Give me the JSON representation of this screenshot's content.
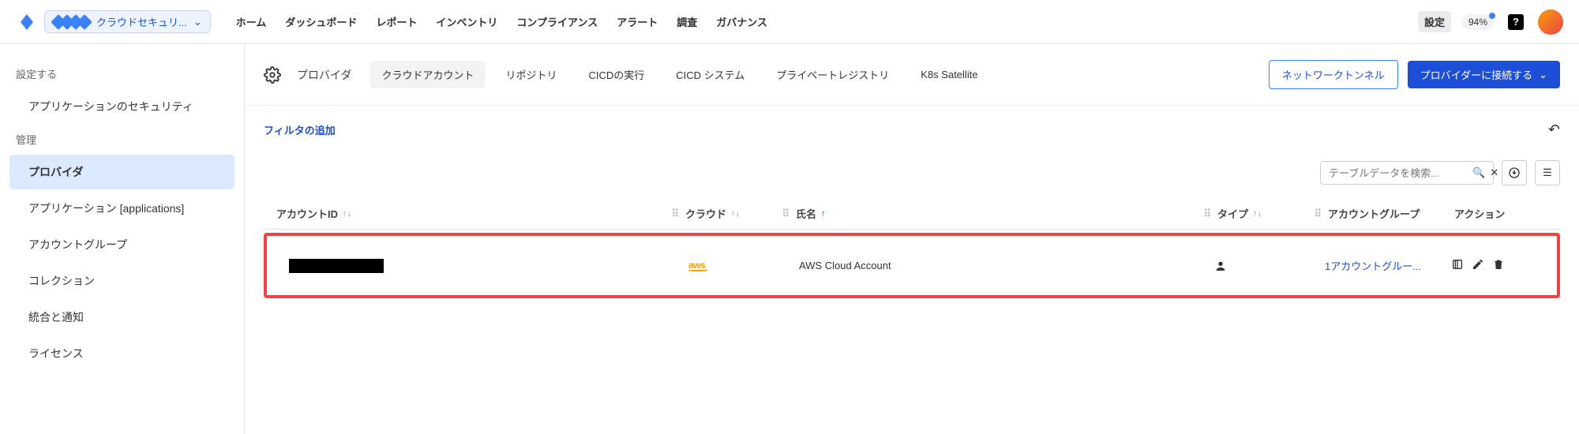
{
  "topbar": {
    "product_label": "クラウドセキュリ...",
    "nav": [
      "ホーム",
      "ダッシュボード",
      "レポート",
      "インベントリ",
      "コンプライアンス",
      "アラート",
      "調査",
      "ガバナンス"
    ],
    "settings_label": "設定",
    "percent": "94%"
  },
  "sidebar": {
    "header_configure": "設定する",
    "item_appsec": "アプリケーションのセキュリティ",
    "header_manage": "管理",
    "items": {
      "provider": "プロバイダ",
      "applications": "アプリケーション [applications]",
      "account_groups": "アカウントグループ",
      "collections": "コレクション",
      "integrations": "統合と通知",
      "license": "ライセンス"
    }
  },
  "subnav": {
    "title": "プロバイダ",
    "tabs": {
      "cloud_accounts": "クラウドアカウント",
      "repository": "リポジトリ",
      "cicd_runs": "CICDの実行",
      "cicd_systems": "CICD システム",
      "private_registry": "プライベートレジストリ",
      "k8s_satellite": "K8s Satellite"
    },
    "network_tunnel": "ネットワークトンネル",
    "connect_provider": "プロバイダーに接続する"
  },
  "filters": {
    "add": "フィルタの追加"
  },
  "table": {
    "search_placeholder": "テーブルデータを検索...",
    "headers": {
      "account_id": "アカウントID",
      "cloud": "クラウド",
      "name": "氏名",
      "type": "タイプ",
      "account_group": "アカウントグループ",
      "actions": "アクション"
    },
    "row": {
      "cloud_logo_text": "aws",
      "name": "AWS Cloud Account",
      "group_link": "1アカウントグルー..."
    }
  }
}
